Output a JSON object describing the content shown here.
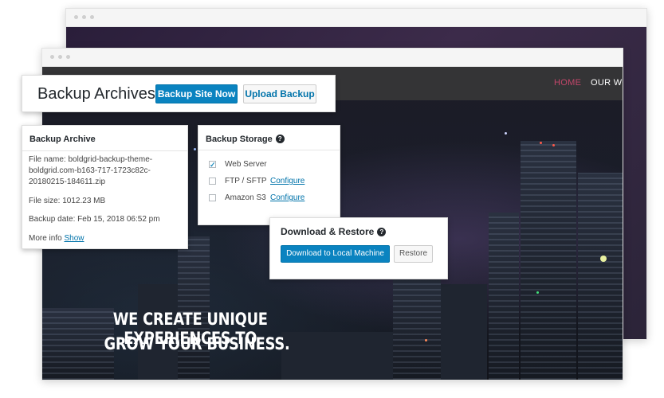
{
  "site": {
    "nav": {
      "home": "HOME",
      "our": "OUR WO"
    },
    "hero": {
      "line1": "WE CREATE UNIQUE EXPERIENCES TO",
      "line2": "GROW YOUR BUSINESS."
    }
  },
  "archives": {
    "title": "Backup Archives",
    "backup_now": "Backup Site Now",
    "upload": "Upload Backup"
  },
  "archive": {
    "title": "Backup Archive",
    "file_label": "File name:",
    "file_name": "boldgrid-backup-theme-boldgrid.com-b163-717-1723c82c-20180215-184611.zip",
    "size_label": "File size:",
    "size": "1012.23 MB",
    "date_label": "Backup date:",
    "date": "Feb 15, 2018 06:52 pm",
    "more_label": "More info",
    "show": "Show"
  },
  "storage": {
    "title": "Backup Storage",
    "help": "?",
    "options": [
      {
        "label": "Web Server",
        "checked": true
      },
      {
        "label": "FTP / SFTP",
        "checked": false,
        "action": "Configure"
      },
      {
        "label": "Amazon S3",
        "checked": false,
        "action": "Configure"
      }
    ]
  },
  "download": {
    "title": "Download & Restore",
    "help": "?",
    "download_btn": "Download to Local Machine",
    "restore_btn": "Restore"
  },
  "colors": {
    "primary": "#0a83c0",
    "link": "#0073aa",
    "nav_active": "#c2466a",
    "navbar": "#343436"
  }
}
